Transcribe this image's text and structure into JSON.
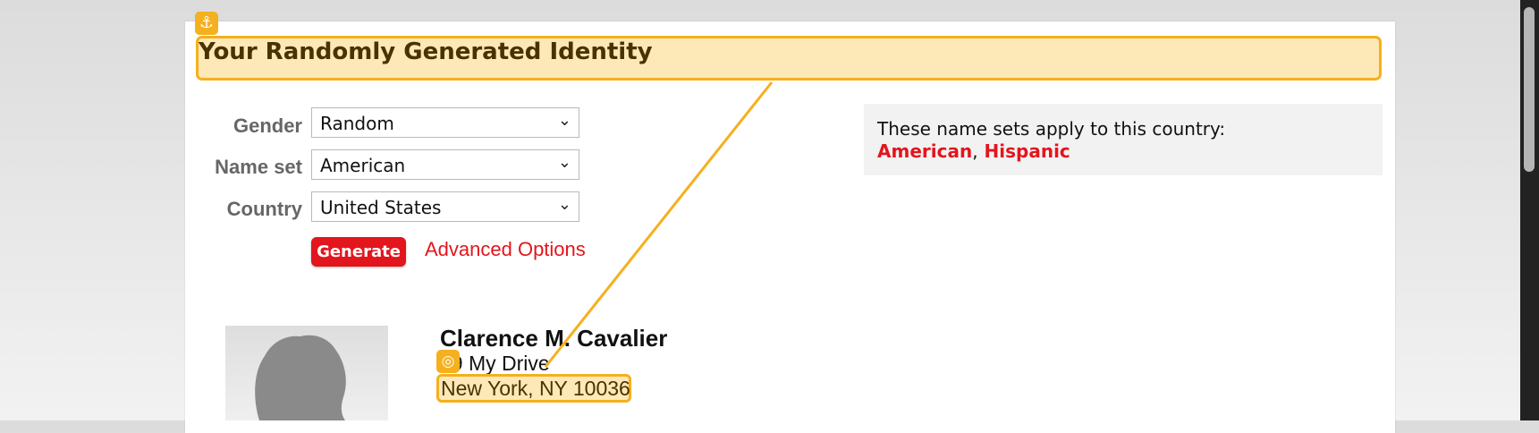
{
  "page": {
    "title": "Your Randomly Generated Identity"
  },
  "form": {
    "gender": {
      "label": "Gender",
      "value": "Random"
    },
    "name_set": {
      "label": "Name set",
      "value": "American"
    },
    "country": {
      "label": "Country",
      "value": "United States"
    },
    "generate_label": "Generate",
    "advanced_label": "Advanced Options"
  },
  "info": {
    "text": "These name sets apply to this country:",
    "links": [
      "American",
      "Hispanic"
    ],
    "separator": ","
  },
  "identity": {
    "name": "Clarence M. Cavalier",
    "street": "59 My Drive",
    "city_line": "New York, NY 10036"
  },
  "annotations": {
    "anchor_icon": "anchor-icon",
    "target_icon": "target-icon",
    "accent_color": "#f5b01e"
  },
  "colors": {
    "brand_red": "#e3151d",
    "highlight_fill": "#fde8b8"
  }
}
